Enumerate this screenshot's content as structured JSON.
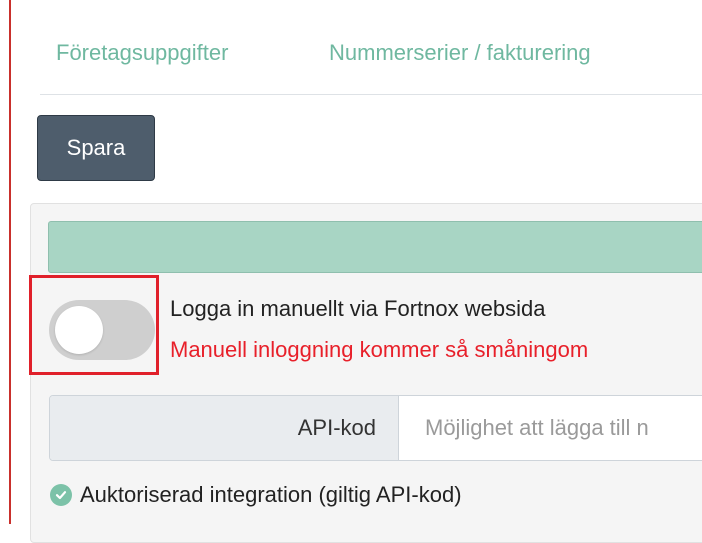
{
  "tabs": [
    {
      "label": "Företagsuppgifter"
    },
    {
      "label": "Nummerserier / fakturering"
    }
  ],
  "toolbar": {
    "save_label": "Spara"
  },
  "integration": {
    "manual_toggle": {
      "label": "Logga in manuellt via Fortnox websida",
      "on": false
    },
    "warning": "Manuell inloggning kommer så småningom",
    "api_code": {
      "label": "API-kod",
      "value": "",
      "placeholder": "Möjlighet att lägga till n"
    },
    "auth_status": "Auktoriserad integration (giltig API-kod)"
  },
  "colors": {
    "accent_tab": "#6fb8a0",
    "save_button": "#4e5d6c",
    "status_bar": "#a8d5c4",
    "warning": "#e8202a",
    "highlight": "#e0202a",
    "check": "#7cc2a8"
  },
  "icons": {
    "auth_status": "check-circle-icon"
  }
}
